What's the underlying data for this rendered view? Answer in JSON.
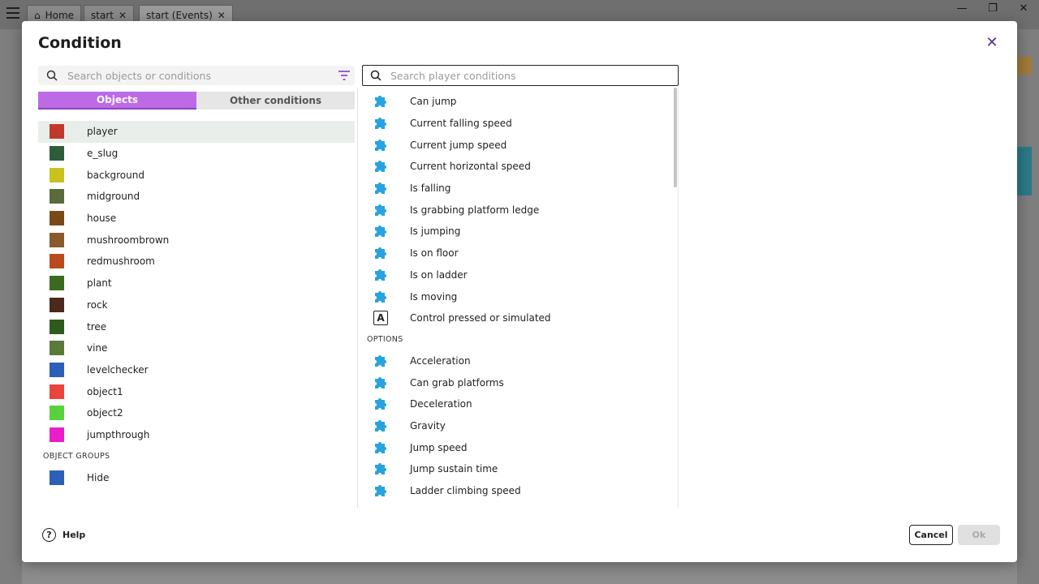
{
  "app_tabs": [
    {
      "label": "Home",
      "icon": "home-icon"
    },
    {
      "label": "start",
      "closable": true
    },
    {
      "label": "start (Events)",
      "closable": true,
      "active": true
    }
  ],
  "dialog": {
    "title": "Condition",
    "close_icon": "close-icon"
  },
  "left_search": {
    "placeholder": "Search objects or conditions"
  },
  "right_search": {
    "placeholder": "Search player conditions"
  },
  "tabs": {
    "objects": "Objects",
    "other": "Other conditions"
  },
  "objects": [
    {
      "label": "player",
      "selected": true,
      "color": "#c0392b"
    },
    {
      "label": "e_slug",
      "color": "#2e5d3a"
    },
    {
      "label": "background",
      "color": "#c8c21c"
    },
    {
      "label": "midground",
      "color": "#5a6b3a"
    },
    {
      "label": "house",
      "color": "#7a4a18"
    },
    {
      "label": "mushroombrown",
      "color": "#8a5a2a"
    },
    {
      "label": "redmushroom",
      "color": "#b84a1e"
    },
    {
      "label": "plant",
      "color": "#3b6b1e"
    },
    {
      "label": "rock",
      "color": "#4a2a1a"
    },
    {
      "label": "tree",
      "color": "#2e5a1a"
    },
    {
      "label": "vine",
      "color": "#5a7a3a"
    },
    {
      "label": "levelchecker",
      "color": "#2b5fb8"
    },
    {
      "label": "object1",
      "color": "#e8453c"
    },
    {
      "label": "object2",
      "color": "#58d13c"
    },
    {
      "label": "jumpthrough",
      "color": "#e81ec8"
    }
  ],
  "object_groups_header": "OBJECT GROUPS",
  "object_groups": [
    {
      "label": "Hide",
      "color": "#2b5fb8"
    }
  ],
  "conditions": [
    {
      "label": "Can jump",
      "icon": "puzzle-icon"
    },
    {
      "label": "Current falling speed",
      "icon": "puzzle-icon"
    },
    {
      "label": "Current jump speed",
      "icon": "puzzle-icon"
    },
    {
      "label": "Current horizontal speed",
      "icon": "puzzle-icon"
    },
    {
      "label": "Is falling",
      "icon": "puzzle-icon"
    },
    {
      "label": "Is grabbing platform ledge",
      "icon": "puzzle-icon"
    },
    {
      "label": "Is jumping",
      "icon": "puzzle-icon"
    },
    {
      "label": "Is on floor",
      "icon": "puzzle-icon"
    },
    {
      "label": "Is on ladder",
      "icon": "puzzle-icon"
    },
    {
      "label": "Is moving",
      "icon": "puzzle-icon"
    },
    {
      "label": "Control pressed or simulated",
      "icon": "keyboard-a-icon",
      "icon_text": "A"
    }
  ],
  "options_header": "OPTIONS",
  "options": [
    {
      "label": "Acceleration",
      "icon": "puzzle-icon"
    },
    {
      "label": "Can grab platforms",
      "icon": "puzzle-icon"
    },
    {
      "label": "Deceleration",
      "icon": "puzzle-icon"
    },
    {
      "label": "Gravity",
      "icon": "puzzle-icon"
    },
    {
      "label": "Jump speed",
      "icon": "puzzle-icon"
    },
    {
      "label": "Jump sustain time",
      "icon": "puzzle-icon"
    },
    {
      "label": "Ladder climbing speed",
      "icon": "puzzle-icon"
    }
  ],
  "footer": {
    "help": "Help",
    "cancel": "Cancel",
    "ok": "Ok"
  },
  "colors": {
    "accent": "#bd6ae6",
    "puzzle": "#29a3e0",
    "close": "#5a2aa8"
  }
}
